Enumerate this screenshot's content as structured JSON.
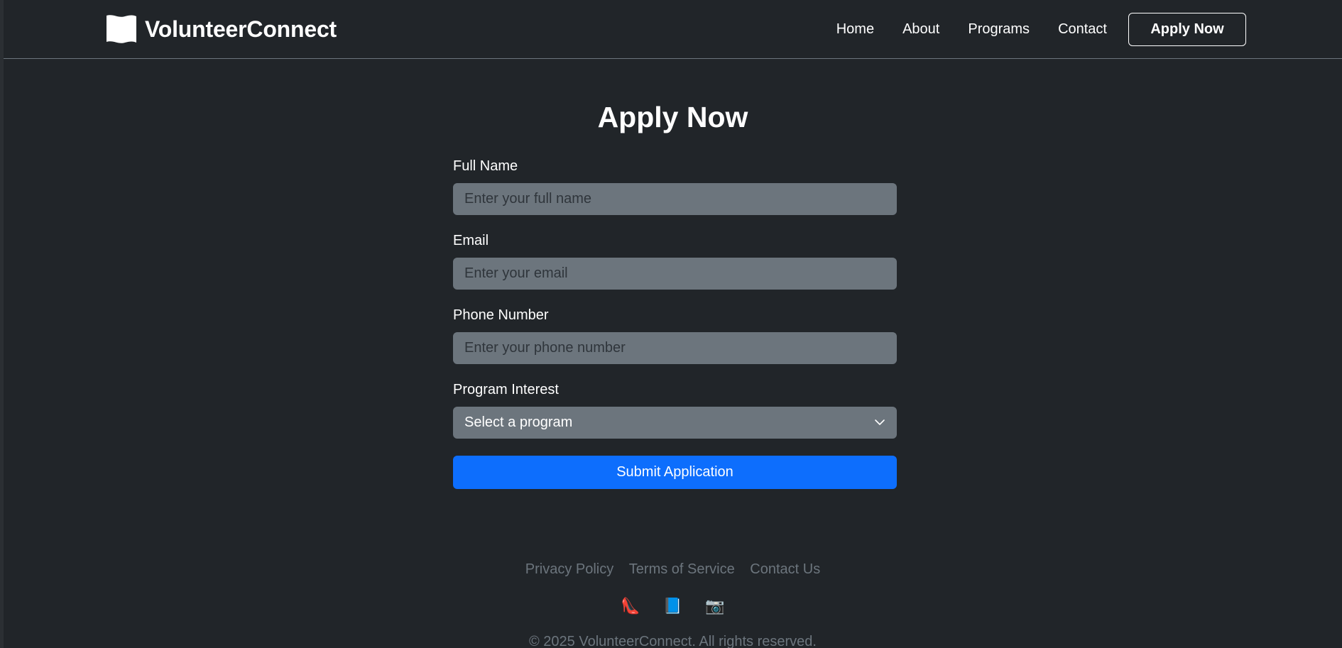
{
  "brand": {
    "name": "VolunteerConnect",
    "icon": "flag-icon"
  },
  "nav": {
    "links": [
      "Home",
      "About",
      "Programs",
      "Contact"
    ],
    "cta": "Apply Now"
  },
  "form": {
    "title": "Apply Now",
    "fields": [
      {
        "label": "Full Name",
        "placeholder": "Enter your full name",
        "value": ""
      },
      {
        "label": "Email",
        "placeholder": "Enter your email",
        "value": ""
      },
      {
        "label": "Phone Number",
        "placeholder": "Enter your phone number",
        "value": ""
      }
    ],
    "program": {
      "label": "Program Interest",
      "selected": "Select a program"
    },
    "submit_label": "Submit Application"
  },
  "footer": {
    "links": [
      "Privacy Policy",
      "Terms of Service",
      "Contact Us"
    ],
    "social": [
      {
        "name": "high-heel-icon",
        "glyph": "👠"
      },
      {
        "name": "book-icon",
        "glyph": "📘"
      },
      {
        "name": "camera-icon",
        "glyph": "📷"
      }
    ],
    "copyright": "© 2025 VolunteerConnect. All rights reserved."
  },
  "colors": {
    "background": "#212529",
    "input_bg": "#6c757d",
    "primary": "#0d6efd",
    "muted_text": "#6c757d"
  }
}
